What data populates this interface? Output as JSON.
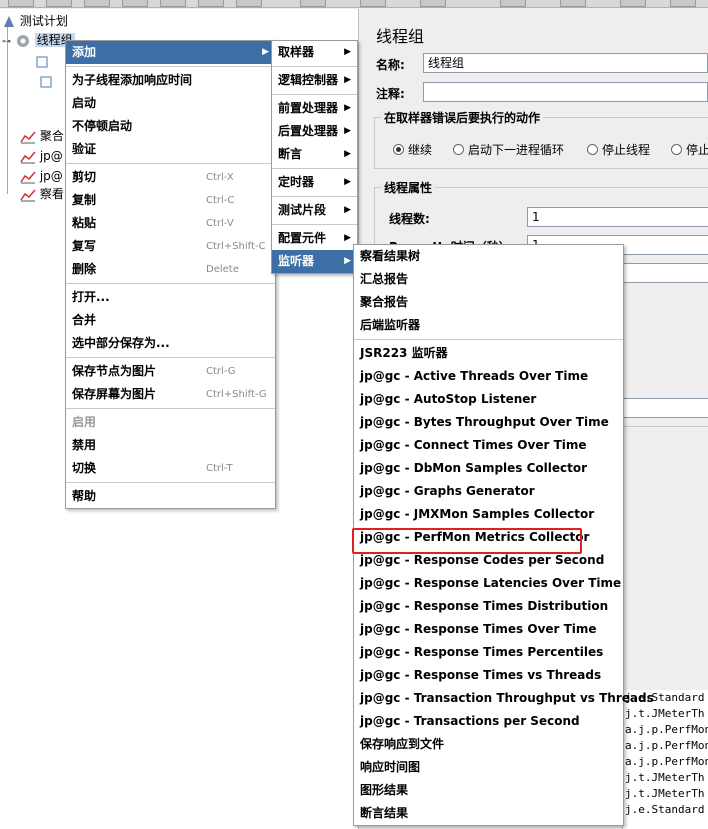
{
  "tree": {
    "items": [
      {
        "label": "测试计划"
      },
      {
        "label": "线程组"
      },
      {
        "label": "聚合"
      },
      {
        "label": "jp@"
      },
      {
        "label": "jp@"
      },
      {
        "label": "察看"
      }
    ]
  },
  "right_panel": {
    "title": "线程组",
    "name_label": "名称:",
    "name_value": "线程组",
    "comment_label": "注释:",
    "comment_value": "",
    "error_group_title": "在取样器错误后要执行的动作",
    "error_options": [
      "继续",
      "启动下一进程循环",
      "停止线程",
      "停止"
    ],
    "selected_error_option": "继续",
    "thread_group_title": "线程属性",
    "threads_label": "线程数:",
    "threads_value": "1",
    "rampup_label": "Ramp-Up时间（秒）:",
    "rampup_value": "1"
  },
  "log_lines": [
    "j.e.Standard",
    "j.t.JMeterTh",
    "a.j.p.PerfMon",
    "a.j.p.PerfMon",
    "a.j.p.PerfMon",
    "j.t.JMeterTh",
    "j.t.JMeterTh",
    "j.e.Standard"
  ],
  "context_menu": {
    "items": [
      {
        "label": "添加",
        "submenu": true,
        "active": true
      },
      {
        "sep": true
      },
      {
        "label": "为子线程添加响应时间"
      },
      {
        "label": "启动"
      },
      {
        "label": "不停顿启动"
      },
      {
        "label": "验证"
      },
      {
        "sep": true
      },
      {
        "label": "剪切",
        "shortcut": "Ctrl-X"
      },
      {
        "label": "复制",
        "shortcut": "Ctrl-C"
      },
      {
        "label": "粘贴",
        "shortcut": "Ctrl-V"
      },
      {
        "label": "复写",
        "shortcut": "Ctrl+Shift-C"
      },
      {
        "label": "删除",
        "shortcut": "Delete"
      },
      {
        "sep": true
      },
      {
        "label": "打开..."
      },
      {
        "label": "合并"
      },
      {
        "label": "选中部分保存为..."
      },
      {
        "sep": true
      },
      {
        "label": "保存节点为图片",
        "shortcut": "Ctrl-G"
      },
      {
        "label": "保存屏幕为图片",
        "shortcut": "Ctrl+Shift-G"
      },
      {
        "sep": true
      },
      {
        "label": "启用",
        "disabled": true
      },
      {
        "label": "禁用"
      },
      {
        "label": "切换",
        "shortcut": "Ctrl-T"
      },
      {
        "sep": true
      },
      {
        "label": "帮助"
      }
    ]
  },
  "add_submenu": {
    "items": [
      {
        "label": "取样器",
        "submenu": true
      },
      {
        "sep": true
      },
      {
        "label": "逻辑控制器",
        "submenu": true
      },
      {
        "sep": true
      },
      {
        "label": "前置处理器",
        "submenu": true
      },
      {
        "label": "后置处理器",
        "submenu": true
      },
      {
        "label": "断言",
        "submenu": true
      },
      {
        "sep": true
      },
      {
        "label": "定时器",
        "submenu": true
      },
      {
        "sep": true
      },
      {
        "label": "测试片段",
        "submenu": true
      },
      {
        "sep": true
      },
      {
        "label": "配置元件",
        "submenu": true
      },
      {
        "label": "监听器",
        "submenu": true,
        "active": true
      }
    ]
  },
  "listener_submenu": {
    "items": [
      {
        "label": "察看结果树"
      },
      {
        "label": "汇总报告"
      },
      {
        "label": "聚合报告"
      },
      {
        "label": "后端监听器"
      },
      {
        "sep": true
      },
      {
        "label": "JSR223 监听器"
      },
      {
        "label": "jp@gc - Active Threads Over Time"
      },
      {
        "label": "jp@gc - AutoStop Listener"
      },
      {
        "label": "jp@gc - Bytes Throughput Over Time"
      },
      {
        "label": "jp@gc - Connect Times Over Time"
      },
      {
        "label": "jp@gc - DbMon Samples Collector"
      },
      {
        "label": "jp@gc - Graphs Generator"
      },
      {
        "label": "jp@gc - JMXMon Samples Collector"
      },
      {
        "label": "jp@gc - PerfMon Metrics Collector",
        "highlighted": true
      },
      {
        "label": "jp@gc - Response Codes per Second"
      },
      {
        "label": "jp@gc - Response Latencies Over Time"
      },
      {
        "label": "jp@gc - Response Times Distribution"
      },
      {
        "label": "jp@gc - Response Times Over Time"
      },
      {
        "label": "jp@gc - Response Times Percentiles"
      },
      {
        "label": "jp@gc - Response Times vs Threads"
      },
      {
        "label": "jp@gc - Transaction Throughput vs Threads"
      },
      {
        "label": "jp@gc - Transactions per Second"
      },
      {
        "label": "保存响应到文件"
      },
      {
        "label": "响应时间图"
      },
      {
        "label": "图形结果"
      },
      {
        "label": "断言结果"
      }
    ]
  }
}
